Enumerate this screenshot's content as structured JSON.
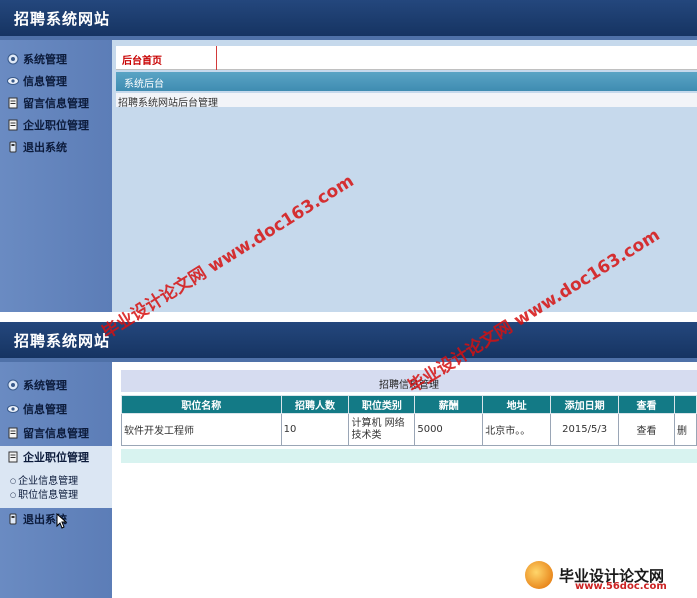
{
  "site_title": "招聘系统网站",
  "sidebar_menu": [
    {
      "label": "系统管理",
      "icon": "gear-icon"
    },
    {
      "label": "信息管理",
      "icon": "eye-icon"
    },
    {
      "label": "留言信息管理",
      "icon": "document-icon"
    },
    {
      "label": "企业职位管理",
      "icon": "document-icon"
    },
    {
      "label": "退出系统",
      "icon": "exit-icon"
    }
  ],
  "screen1": {
    "tab_label": "后台首页",
    "breadcrumb": "系统后台",
    "description": "招聘系统网站后台管理"
  },
  "screen2": {
    "submenu": [
      "企业信息管理",
      "职位信息管理"
    ],
    "subtitle": "招聘信息管理",
    "table": {
      "headers": [
        "职位名称",
        "招聘人数",
        "职位类别",
        "薪酬",
        "地址",
        "添加日期",
        "查看",
        ""
      ],
      "rows": [
        [
          "软件开发工程师",
          "10",
          "计算机 网络 技术类",
          "5000",
          "北京市。。",
          "2015/5/3",
          "查看",
          "删"
        ]
      ]
    }
  },
  "watermark_text": "毕业设计论文网 www.doc163.com",
  "watermark_logo": {
    "title": "毕业设计论文网",
    "url": "www.56doc.com"
  }
}
